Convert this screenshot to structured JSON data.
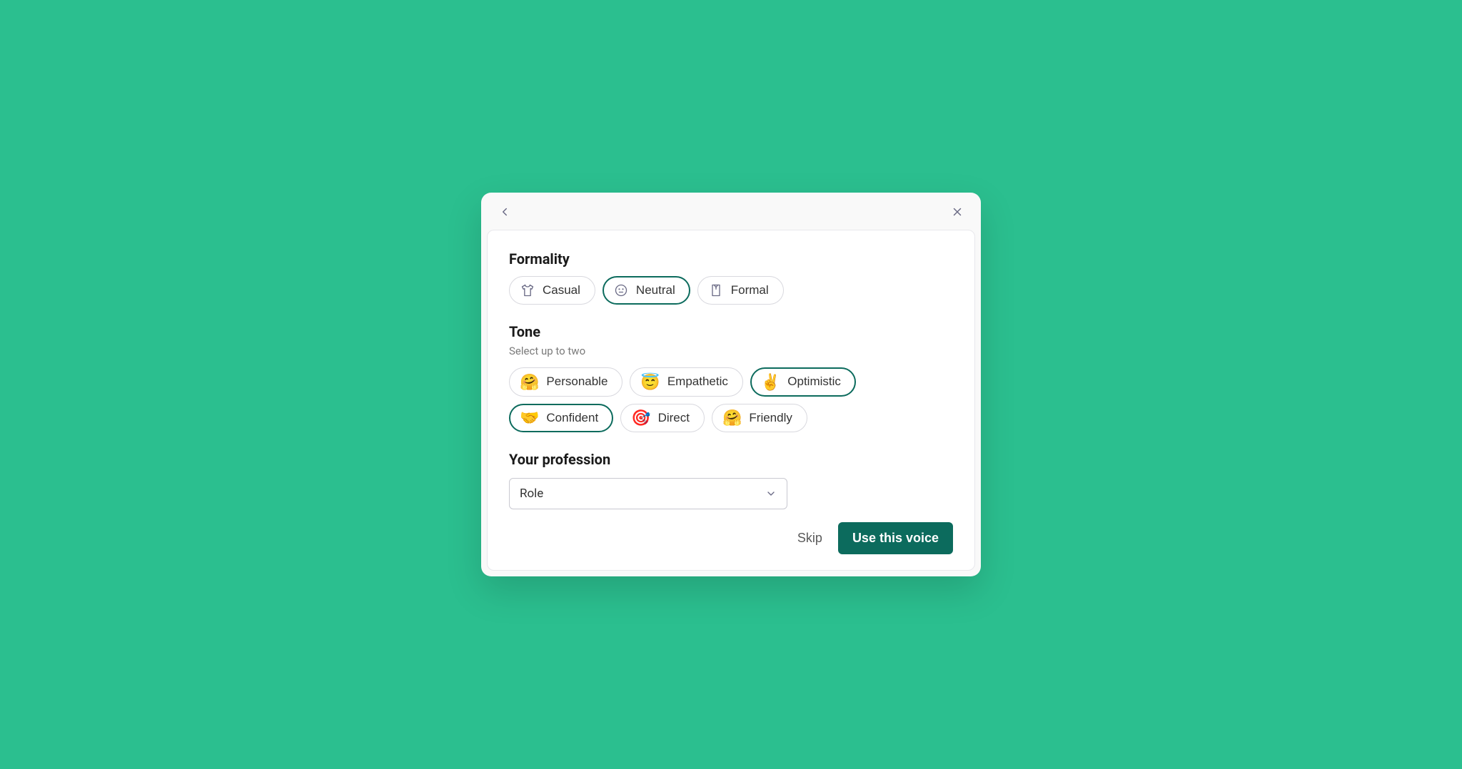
{
  "formality": {
    "title": "Formality",
    "options": [
      {
        "label": "Casual",
        "icon": "tshirt",
        "selected": false
      },
      {
        "label": "Neutral",
        "icon": "neutral-face",
        "selected": true
      },
      {
        "label": "Formal",
        "icon": "shirt-collar",
        "selected": false
      }
    ]
  },
  "tone": {
    "title": "Tone",
    "subtitle": "Select up to two",
    "options": [
      {
        "label": "Personable",
        "emoji": "🤗",
        "selected": false
      },
      {
        "label": "Empathetic",
        "emoji": "😇",
        "selected": false
      },
      {
        "label": "Optimistic",
        "emoji": "✌️",
        "selected": true
      },
      {
        "label": "Confident",
        "emoji": "🤝",
        "selected": true
      },
      {
        "label": "Direct",
        "emoji": "🎯",
        "selected": false
      },
      {
        "label": "Friendly",
        "emoji": "🤗",
        "selected": false
      }
    ]
  },
  "profession": {
    "title": "Your profession",
    "placeholder": "Role"
  },
  "footer": {
    "skip": "Skip",
    "submit": "Use this voice"
  }
}
